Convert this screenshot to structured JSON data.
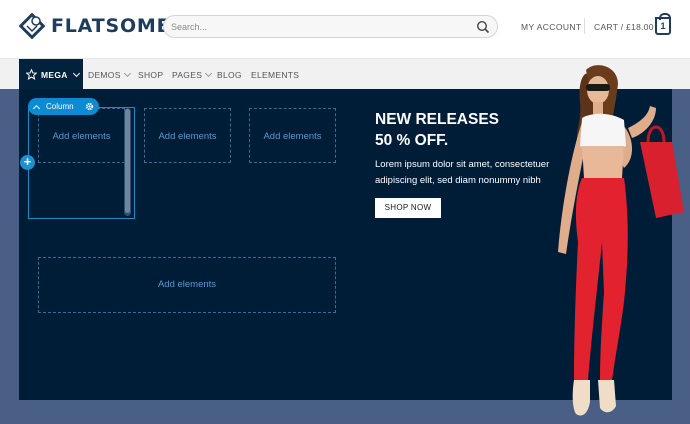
{
  "header": {
    "logo_text": "FLATSOME",
    "search_placeholder": "Search...",
    "account_label": "MY ACCOUNT",
    "cart_label": "CART / £18.00",
    "cart_count": "1"
  },
  "nav": {
    "items": [
      {
        "label": "MEGA",
        "active": true,
        "has_dropdown": true
      },
      {
        "label": "DEMOS",
        "has_dropdown": true
      },
      {
        "label": "SHOP"
      },
      {
        "label": "PAGES",
        "has_dropdown": true
      },
      {
        "label": "BLOG"
      },
      {
        "label": "ELEMENTS"
      }
    ]
  },
  "builder": {
    "column_tag": "Column",
    "add_elements_label": "Add elements"
  },
  "promo": {
    "title_line1": "NEW RELEASES",
    "title_line2": "50 % OFF.",
    "text": "Lorem ipsum dolor sit amet, consectetuer adipiscing elit, sed diam nonummy nibh",
    "button": "SHOP NOW"
  },
  "colors": {
    "brand_dark": "#1f3c5a",
    "mega_bg": "#001d38",
    "page_bg": "#4a5f85",
    "builder_accent": "#0d8ad0"
  }
}
